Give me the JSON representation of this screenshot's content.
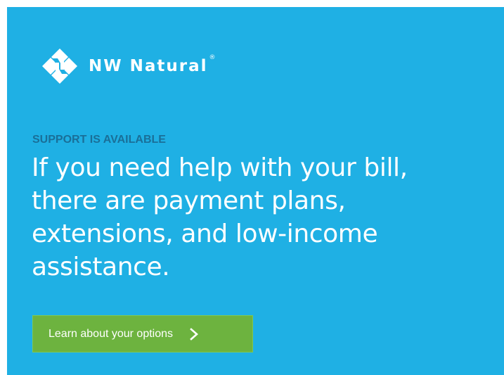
{
  "brand": {
    "name": "NW Natural",
    "registered_mark": "®",
    "logo_icon": "nw-natural-logo-icon"
  },
  "banner": {
    "eyebrow": "SUPPORT IS AVAILABLE",
    "headline_lines": [
      "If you need help with your bill,",
      "there are payment plans,",
      "extensions, and low-income",
      "assistance."
    ]
  },
  "cta": {
    "label": "Learn about your options",
    "icon": "chevron-right-icon"
  },
  "colors": {
    "banner_background": "#1fb0e4",
    "eyebrow_text": "#1a6f98",
    "cta_background": "#6db33f",
    "text": "#ffffff"
  }
}
